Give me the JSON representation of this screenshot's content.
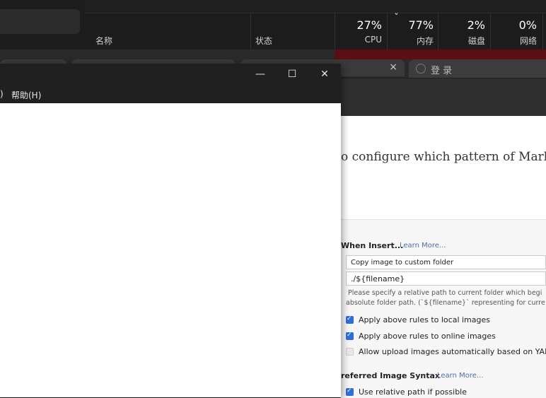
{
  "task_manager": {
    "columns": {
      "name": "名称",
      "status": "状态",
      "cpu": {
        "value": "27%",
        "label": "CPU"
      },
      "memory": {
        "value": "77%",
        "label": "内存"
      },
      "disk": {
        "value": "2%",
        "label": "磁盘"
      },
      "network": {
        "value": "0%",
        "label": "网络"
      }
    },
    "sort_indicator": "ˇ"
  },
  "browser": {
    "tab_close": "×",
    "login_tab": "登 录",
    "content_line": "o configure which pattern of Markdo"
  },
  "typora_prefs": {
    "when_insert": {
      "title": "When Insert...",
      "learn_more": "Learn More..."
    },
    "insert_action": "Copy image to custom folder",
    "folder_path": "./${filename}",
    "hint_line_1": "Please specify a relative path to current folder which begi",
    "hint_line_2": "absolute folder path. (`${filename}` representing for curre",
    "checkboxes": [
      {
        "label": "Apply above rules to local images",
        "checked": true
      },
      {
        "label": "Apply above rules to online images",
        "checked": true
      },
      {
        "label": "Allow upload images automatically based on YAML",
        "checked": false
      }
    ],
    "preferred_syntax": {
      "title": "referred Image Syntax",
      "learn_more": "Learn More..."
    },
    "relative_path": {
      "label": "Use relative path if possible",
      "checked": true
    }
  },
  "window": {
    "minimize": "—",
    "maximize": "☐",
    "close": "✕",
    "menu_partial": ")",
    "menu_help": "帮助(H)"
  }
}
